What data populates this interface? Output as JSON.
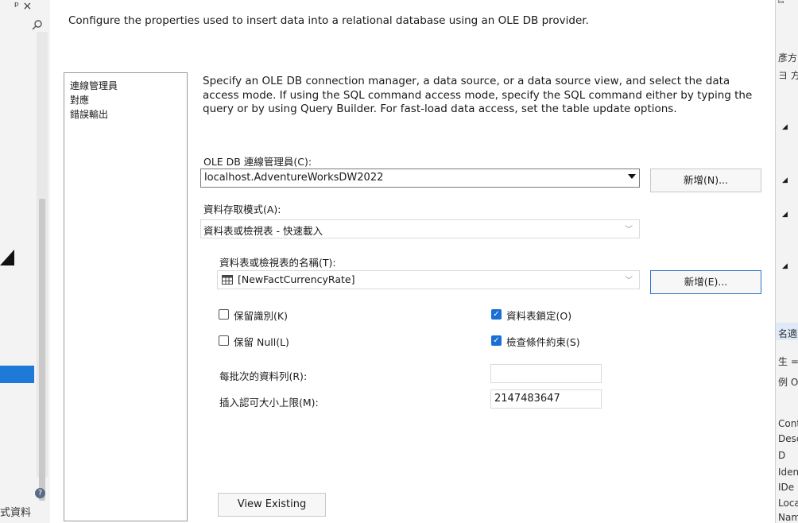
{
  "left_strip": {
    "pin_glyph": "ᵖ ×",
    "bottom_text": "式資料",
    "help_glyph": "?"
  },
  "dialog": {
    "description": "Configure the properties used to insert data into a relational database using an OLE DB provider.",
    "nav_items": [
      "連線管理員",
      "對應",
      "錯誤輸出"
    ],
    "intro_text": "Specify an OLE DB connection manager, a data source, or a data source view, and select the data access mode. If using the SQL command access mode, specify the SQL command either by typing the query or by using Query Builder. For fast-load data access, set the table update options.",
    "connection_manager": {
      "label": "OLE DB 連線管理員(C):",
      "value": "localhost.AdventureWorksDW2022",
      "new_button": "新增(N)..."
    },
    "access_mode": {
      "label": "資料存取模式(A):",
      "value": "資料表或檢視表 - 快速載入"
    },
    "table_name": {
      "label": "資料表或檢視表的名稱(T):",
      "value": "[NewFactCurrencyRate]",
      "new_button": "新增(E)..."
    },
    "options": {
      "keep_identity": {
        "label": "保留識別(K)",
        "checked": false
      },
      "keep_nulls": {
        "label": "保留 Null(L)",
        "checked": false
      },
      "table_lock": {
        "label": "資料表鎖定(O)",
        "checked": true
      },
      "check_constraints": {
        "label": "檢查條件約束(S)",
        "checked": true
      }
    },
    "rows_per_batch": {
      "label": "每批次的資料列(R):",
      "value": ""
    },
    "max_commit_size": {
      "label": "插入認可大小上限(M):",
      "value": "2147483647"
    },
    "view_existing_button": "View Existing",
    "accent_color": "#1a6fd4"
  },
  "right_strip": {
    "texts": [
      "ᵇᵃ",
      "彥方",
      "ヨ 方",
      "名適",
      "生 =",
      "例 O",
      "Cont",
      "Desc",
      "D",
      "Iden",
      "IDe",
      "Loca",
      "Nam"
    ]
  }
}
